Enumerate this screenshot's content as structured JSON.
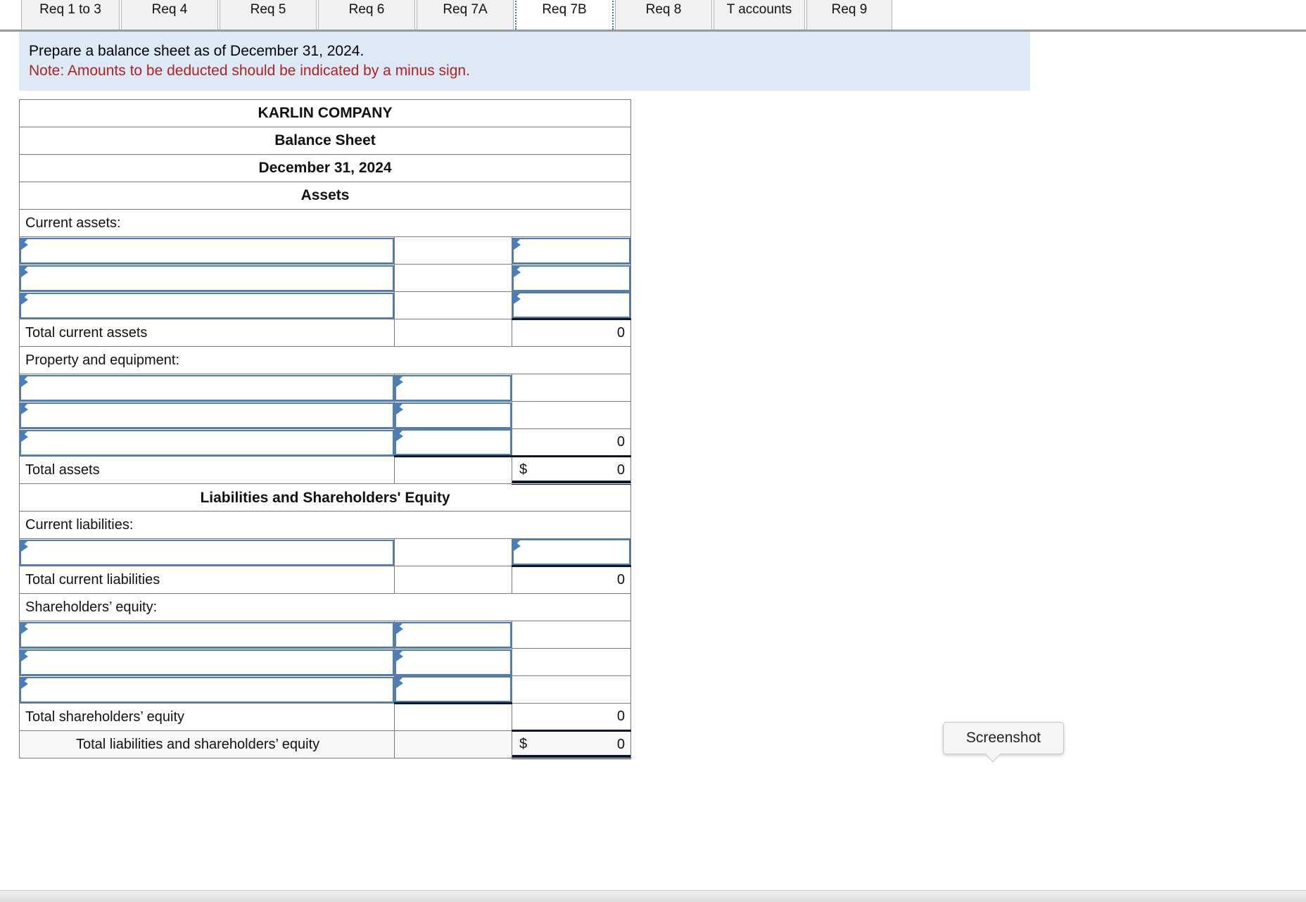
{
  "tabs": [
    {
      "label": "Req 1 to 3",
      "active": false
    },
    {
      "label": "Req 4",
      "active": false
    },
    {
      "label": "Req 5",
      "active": false
    },
    {
      "label": "Req 6",
      "active": false
    },
    {
      "label": "Req 7A",
      "active": false
    },
    {
      "label": "Req 7B",
      "active": true
    },
    {
      "label": "Req 8",
      "active": false
    },
    {
      "label": "T accounts",
      "active": false
    },
    {
      "label": "Req 9",
      "active": false
    }
  ],
  "banner": {
    "instruction": "Prepare a balance sheet as of December 31, 2024.",
    "note": "Note: Amounts to be deducted should be indicated by a minus sign."
  },
  "sheet": {
    "company": "KARLIN COMPANY",
    "statement": "Balance Sheet",
    "date": "December 31, 2024",
    "assets_heading": "Assets",
    "current_assets_label": "Current assets:",
    "total_current_assets_label": "Total current assets",
    "total_current_assets_value": "0",
    "property_label": "Property and equipment:",
    "property_subtotal_value": "0",
    "total_assets_label": "Total assets",
    "total_assets_dollar": "$",
    "total_assets_value": "0",
    "liabilities_heading": "Liabilities and Shareholders' Equity",
    "current_liabilities_label": "Current liabilities:",
    "total_current_liabilities_label": "Total current liabilities",
    "total_current_liabilities_value": "0",
    "equity_label": "Shareholders’ equity:",
    "total_equity_label": "Total shareholders’ equity",
    "total_equity_value": "0",
    "total_liab_equity_label": "Total liabilities and shareholders’ equity",
    "total_liab_equity_dollar": "$",
    "total_liab_equity_value": "0",
    "input_placeholder": ""
  },
  "tooltip": {
    "label": "Screenshot"
  },
  "colors": {
    "header_blue": "#85aade",
    "banner_blue": "#ddeaf6",
    "note_red": "#b32020",
    "input_border": "#4a7ebb",
    "grid": "#7a7a7a"
  }
}
